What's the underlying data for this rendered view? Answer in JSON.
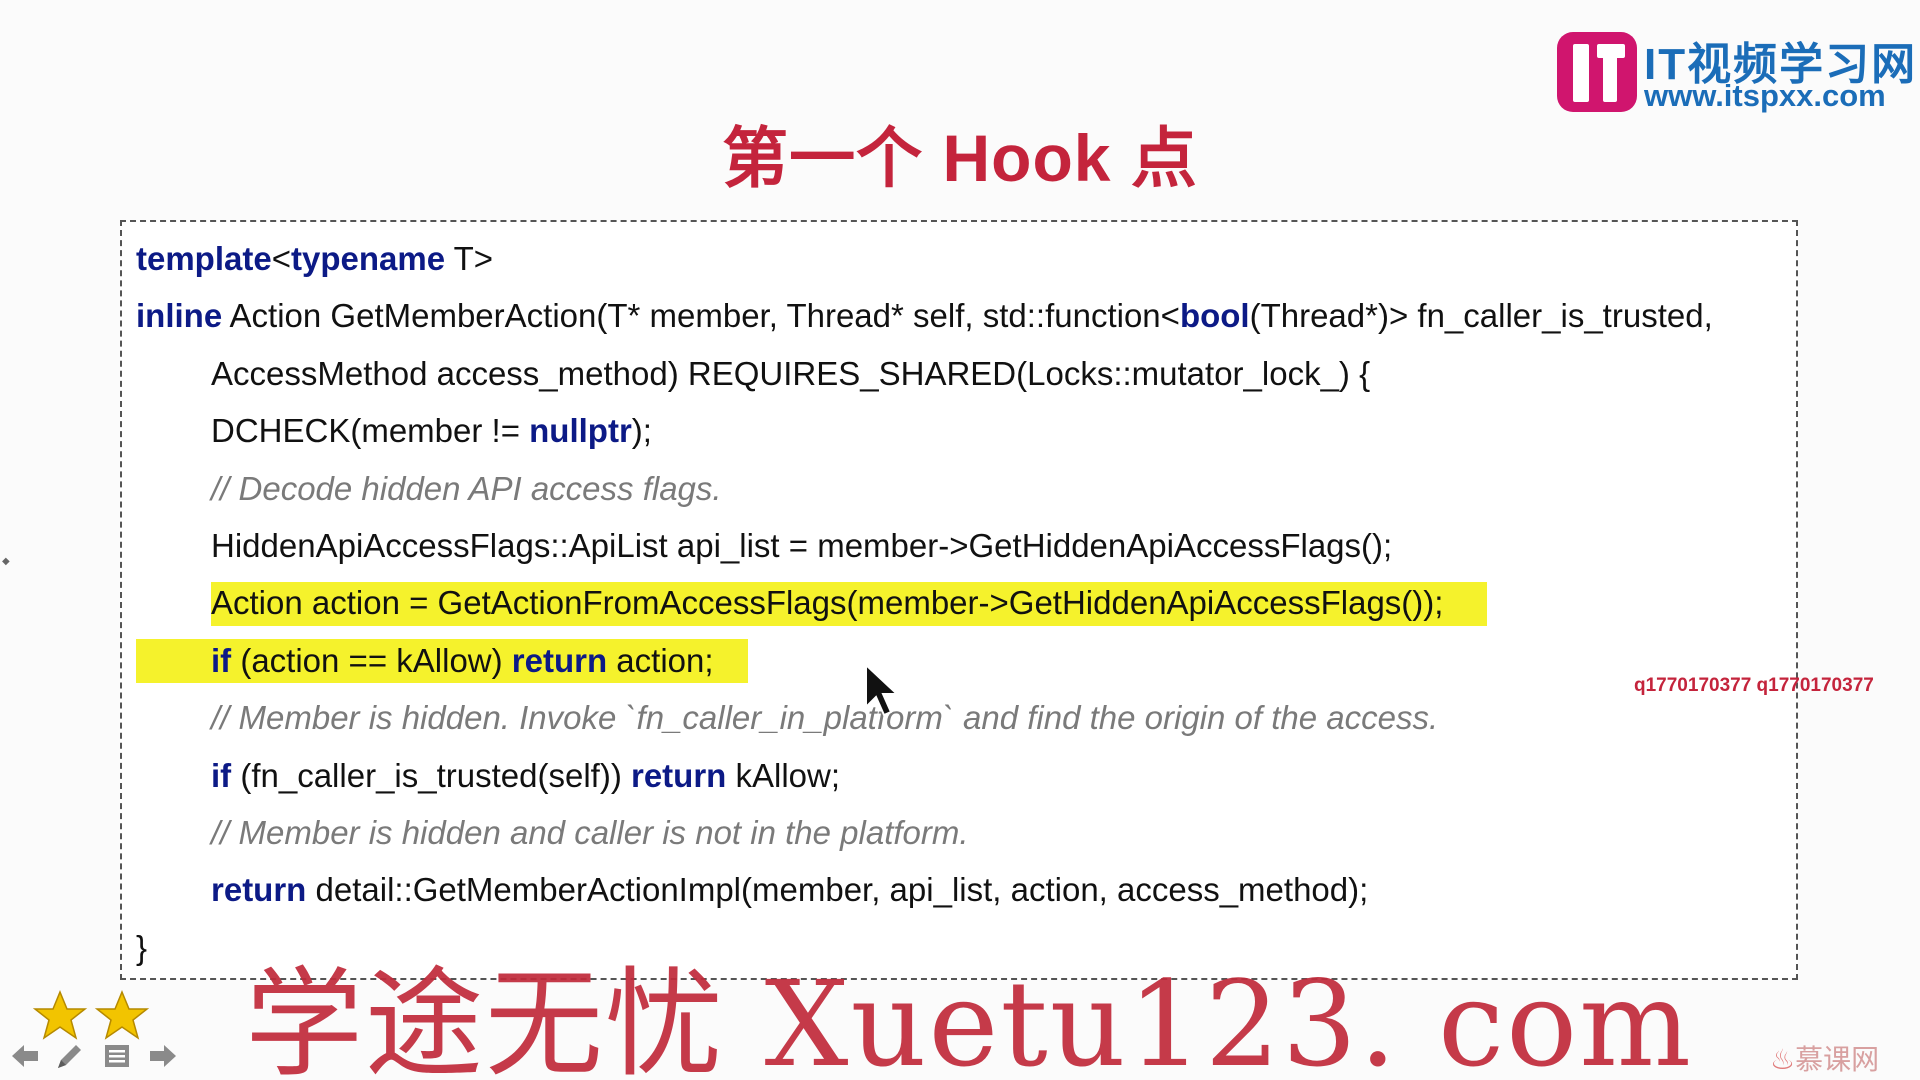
{
  "slide": {
    "title": "第一个 Hook 点"
  },
  "logo": {
    "cn": "IT视频学习网",
    "url": "www.itspxx.com"
  },
  "code": {
    "l1": {
      "kw1": "template",
      "t1": "<",
      "kw2": "typename",
      "t2": " T>"
    },
    "l2": {
      "kw1": "inline",
      "t1": " Action GetMemberAction(T* member, Thread* self, std::function<",
      "kw2": "bool",
      "t2": "(Thread*)> fn_caller_is_trusted,"
    },
    "l3": {
      "t1": "AccessMethod access_method) REQUIRES_SHARED(Locks::mutator_lock_) {"
    },
    "l4": {
      "t1": "DCHECK(member != ",
      "kw1": "nullptr",
      "t2": ");"
    },
    "l5": {
      "c1": "// Decode hidden API access flags."
    },
    "l6": {
      "t1": "HiddenApiAccessFlags::ApiList api_list = member->GetHiddenApiAccessFlags();"
    },
    "l7": {
      "t1": "Action action = GetActionFromAccessFlags(member->GetHiddenApiAccessFlags());"
    },
    "l8": {
      "kw1": "if",
      "t1": " (action == kAllow) ",
      "kw2": "return",
      "t2": " action;"
    },
    "l9": {
      "c1": "// Member is hidden. Invoke `fn_caller_in_platform` and find the origin of the access."
    },
    "l10": {
      "kw1": "if",
      "t1": " (fn_caller_is_trusted(self)) ",
      "kw2": "return",
      "t2": " kAllow;"
    },
    "l11": {
      "c1": "// Member is hidden and caller is not in the platform."
    },
    "l12": {
      "kw1": "return",
      "t1": " detail::GetMemberActionImpl(member, api_list, action, access_method);"
    },
    "l13": {
      "t1": "}"
    }
  },
  "overlay": {
    "id_watermark": "q1770170377 q1770170377",
    "big_watermark": "学途无忧 Xuetu123. com",
    "corner_brand": "慕课网"
  },
  "icons": [
    "star-icon",
    "star-icon",
    "prev-arrow-icon",
    "pen-icon",
    "menu-icon",
    "next-arrow-icon",
    "mouse-cursor-icon"
  ],
  "colors": {
    "title": "#c4243c",
    "keyword": "#0c1a86",
    "comment": "#7a7a7a",
    "highlight": "#f5f22c",
    "logo": "#d0156e",
    "logo_text": "#1b6db8"
  }
}
